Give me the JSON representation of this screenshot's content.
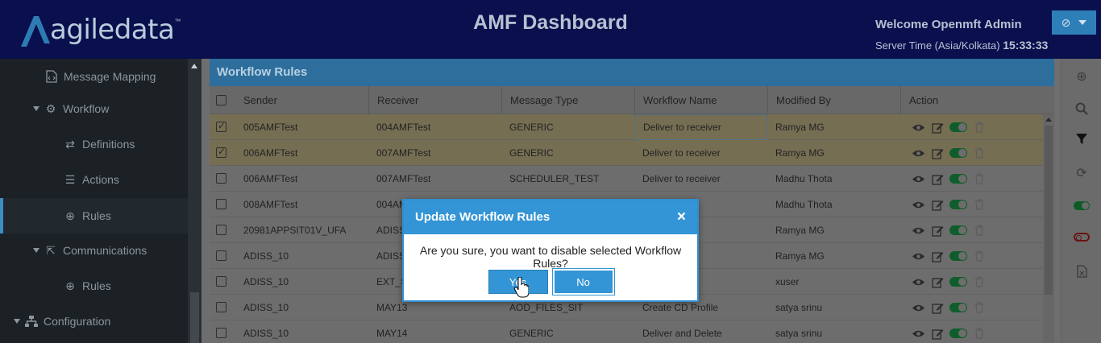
{
  "header": {
    "logo_text": "agiledata",
    "logo_tm": "™",
    "title": "AMF Dashboard",
    "welcome": "Welcome Openmft Admin",
    "server_time_label": "Server Time (Asia/Kolkata)",
    "server_time": "15:33:33",
    "user_icon": "circle-slash-icon"
  },
  "sidebar": {
    "items": [
      {
        "label": "Message Mapping",
        "icon": "document-code-icon"
      },
      {
        "label": "Workflow",
        "icon": "gear-icon"
      },
      {
        "label": "Definitions",
        "icon": "arrows-swap-icon"
      },
      {
        "label": "Actions",
        "icon": "list-icon"
      },
      {
        "label": "Rules",
        "icon": "circle-down-icon"
      },
      {
        "label": "Communications",
        "icon": "share-icon"
      },
      {
        "label": "Rules",
        "icon": "circle-down-icon"
      },
      {
        "label": "Configuration",
        "icon": "sitemap-icon"
      }
    ]
  },
  "panel": {
    "title": "Workflow Rules",
    "columns": [
      "Sender",
      "Receiver",
      "Message Type",
      "Workflow Name",
      "Modified By",
      "Action"
    ],
    "rows": [
      {
        "sender": "005AMFTest",
        "receiver": "004AMFTest",
        "message_type": "GENERIC",
        "workflow_name": "Deliver to receiver",
        "modified_by": "Ramya MG",
        "checked": true
      },
      {
        "sender": "006AMFTest",
        "receiver": "007AMFTest",
        "message_type": "GENERIC",
        "workflow_name": "Deliver to receiver",
        "modified_by": "Ramya MG",
        "checked": true
      },
      {
        "sender": "006AMFTest",
        "receiver": "007AMFTest",
        "message_type": "SCHEDULER_TEST",
        "workflow_name": "Deliver to receiver",
        "modified_by": "Madhu Thota",
        "checked": false
      },
      {
        "sender": "008AMFTest",
        "receiver": "004AM",
        "message_type": "",
        "workflow_name": "eiver",
        "modified_by": "Madhu Thota",
        "checked": false
      },
      {
        "sender": "20981APPSIT01V_UFA",
        "receiver": "ADISS",
        "message_type": "",
        "workflow_name": "ofile",
        "modified_by": "Ramya MG",
        "checked": false
      },
      {
        "sender": "ADISS_10",
        "receiver": "ADISS",
        "message_type": "",
        "workflow_name": "ofile",
        "modified_by": "Ramya MG",
        "checked": false
      },
      {
        "sender": "ADISS_10",
        "receiver": "EXT_S",
        "message_type": "",
        "workflow_name": "",
        "modified_by": "xuser",
        "checked": false
      },
      {
        "sender": "ADISS_10",
        "receiver": "MAY13",
        "message_type": "AOD_FILES_SIT",
        "workflow_name": "Create CD Profile",
        "modified_by": "satya srinu",
        "checked": false
      },
      {
        "sender": "ADISS_10",
        "receiver": "MAY14",
        "message_type": "GENERIC",
        "workflow_name": "Deliver and Delete",
        "modified_by": "satya srinu",
        "checked": false
      }
    ]
  },
  "toolbar": {
    "icons": [
      "plus-circle-icon",
      "search-icon",
      "filter-icon",
      "refresh-icon",
      "toggle-on-icon",
      "toggle-off-icon",
      "export-file-icon"
    ]
  },
  "modal": {
    "title": "Update Workflow Rules",
    "close": "×",
    "message": "Are you sure, you want to disable selected Workflow Rules?",
    "yes": "Yes",
    "no": "No"
  }
}
